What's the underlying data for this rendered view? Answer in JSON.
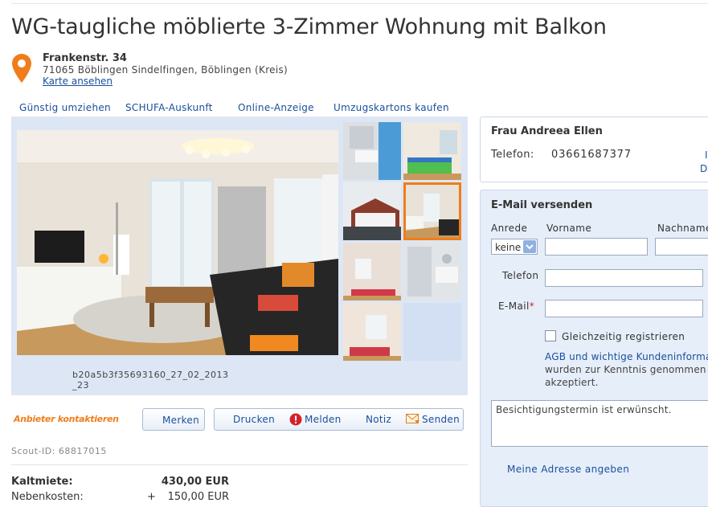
{
  "title": "WG-taugliche möblierte 3-Zimmer Wohnung mit Balkon",
  "address": {
    "street": "Frankenstr. 34",
    "city": "71065 Böblingen Sindelfingen, Böblingen (Kreis)",
    "map_link": "Karte ansehen"
  },
  "nav": [
    "Günstig umziehen",
    "SCHUFA-Auskunft",
    "Online-Anzeige",
    "Umzugskartons kaufen"
  ],
  "gallery": {
    "caption": "b20a5b3f35693160_27_02_2013_23"
  },
  "actions": {
    "contact": "Anbieter kontaktieren",
    "merken": "Merken",
    "drucken": "Drucken",
    "melden": "Melden",
    "notiz": "Notiz",
    "senden": "Senden"
  },
  "scout_id": "Scout-ID: 68817015",
  "prices": [
    {
      "label": "Kaltmiete:",
      "prefix": "",
      "value": "430,00 EUR"
    },
    {
      "label": "Nebenkosten:",
      "prefix": "+",
      "value": "150,00 EUR"
    }
  ],
  "contact": {
    "name": "Frau Andreea Ellen",
    "phone_label": "Telefon:",
    "phone": "03661687377",
    "cut_1": "I",
    "cut_2": "D"
  },
  "email_form": {
    "heading": "E-Mail versenden",
    "anrede_label": "Anrede",
    "anrede_value": "keine",
    "vorname_label": "Vorname",
    "nachname_label": "Nachname",
    "telefon_label": "Telefon",
    "email_label": "E-Mail",
    "required_mark": "*",
    "register_label": "Gleichzeitig registrieren",
    "terms_link": "AGB und wichtige Kundeninforma",
    "terms_text_1": "wurden zur Kenntnis genommen u",
    "terms_text_2": "akzeptiert.",
    "message": "Besichtigungstermin ist erwünscht.",
    "address_link": "Meine Adresse angeben"
  },
  "colors": {
    "accent": "#f07d1a",
    "link": "#1a4f9c",
    "panel_bg": "#e6eef9",
    "gallery_bg": "#dde6f5"
  }
}
